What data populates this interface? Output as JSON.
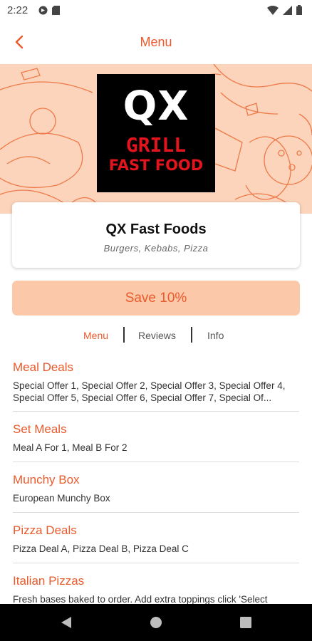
{
  "status_bar": {
    "time": "2:22"
  },
  "header": {
    "title": "Menu"
  },
  "hero": {
    "logo_line1": "QX",
    "logo_line2": "GRILL",
    "logo_line3": "FAST FOOD"
  },
  "restaurant": {
    "name": "QX Fast Foods",
    "cuisines": "Burgers, Kebabs, Pizza"
  },
  "offer": {
    "label": "Save 10%"
  },
  "tabs": [
    {
      "label": "Menu",
      "active": true
    },
    {
      "label": "Reviews",
      "active": false
    },
    {
      "label": "Info",
      "active": false
    }
  ],
  "menu_sections": [
    {
      "title": "Meal Deals",
      "description": "Special Offer 1, Special Offer 2, Special Offer 3, Special Offer 4, Special Offer 5, Special Offer 6, Special Offer 7, Special Of..."
    },
    {
      "title": "Set Meals",
      "description": "Meal A For 1, Meal B For 2"
    },
    {
      "title": "Munchy Box",
      "description": "European Munchy Box"
    },
    {
      "title": "Pizza Deals",
      "description": "Pizza Deal A, Pizza Deal B, Pizza Deal C"
    },
    {
      "title": "Italian Pizzas",
      "description": "Fresh bases baked to order. Add extra toppings click 'Select"
    }
  ],
  "colors": {
    "accent": "#ea5a2b",
    "hero_bg": "#fcd3bb",
    "save_bg": "#fcc8aa"
  },
  "icons": {
    "back": "chevron-left-icon",
    "nav_back": "triangle-back-icon",
    "nav_home": "circle-home-icon",
    "nav_recents": "square-recents-icon"
  }
}
